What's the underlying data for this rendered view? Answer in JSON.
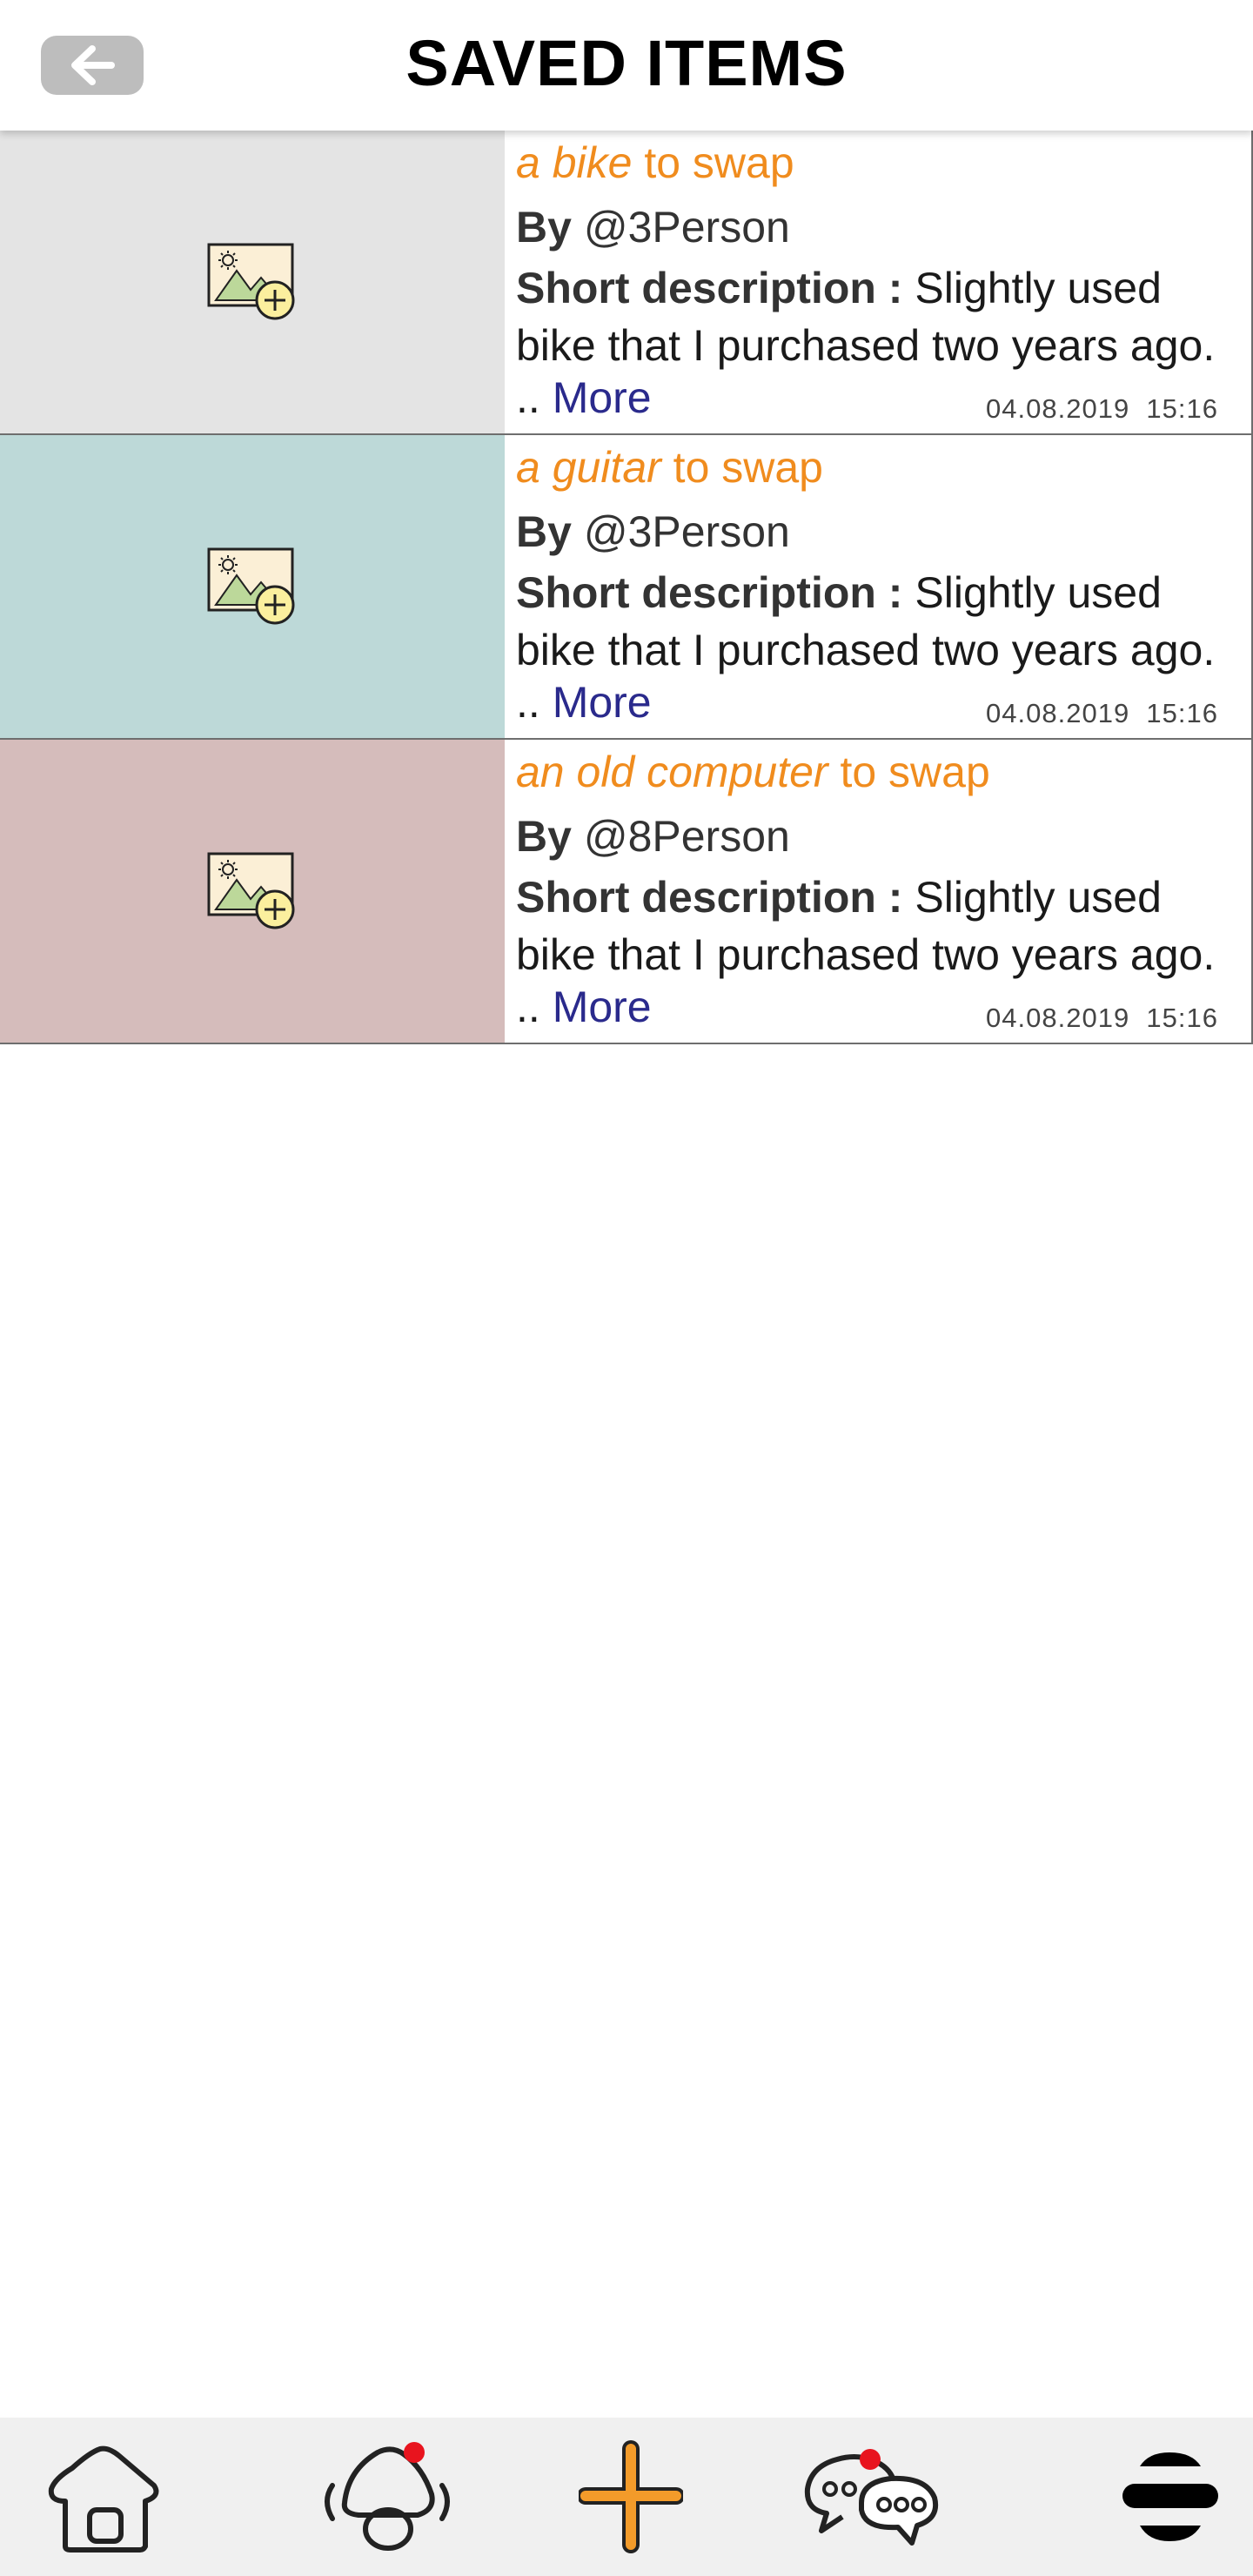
{
  "header": {
    "title": "SAVED ITEMS",
    "back_icon": "arrow-left-icon"
  },
  "items": [
    {
      "thumb_color": "#e4e4e4",
      "name": "a bike",
      "suffix": " to swap",
      "by_label": "By",
      "user": "@3Person",
      "desc_label": "Short description :",
      "desc": "Slightly used bike that I purchased two years ago.",
      "more_prefix": ".. ",
      "more": "More",
      "date": "04.08.2019",
      "time": "15:16"
    },
    {
      "thumb_color": "#bdd9d8",
      "name": "a guitar",
      "suffix": " to swap",
      "by_label": "By",
      "user": "@3Person",
      "desc_label": "Short description :",
      "desc": "Slightly used bike that I purchased two years ago.",
      "more_prefix": ".. ",
      "more": "More",
      "date": "04.08.2019",
      "time": "15:16"
    },
    {
      "thumb_color": "#d5bcbb",
      "name": "an old computer",
      "suffix": " to swap",
      "by_label": "By",
      "user": "@8Person",
      "desc_label": "Short description :",
      "desc": "Slightly used bike that I purchased two years ago.",
      "more_prefix": ".. ",
      "more": "More",
      "date": "04.08.2019",
      "time": "15:16"
    }
  ],
  "colors": {
    "title_accent": "#f08c1e",
    "link": "#2a2a8c",
    "notification_dot": "#e8141e",
    "nav_bg": "#f0f0f0"
  },
  "nav": {
    "items": [
      {
        "icon": "home-icon"
      },
      {
        "icon": "notifications-icon",
        "has_badge": true
      },
      {
        "icon": "add-icon"
      },
      {
        "icon": "chat-icon",
        "has_badge": true
      },
      {
        "icon": "menu-icon"
      }
    ]
  }
}
